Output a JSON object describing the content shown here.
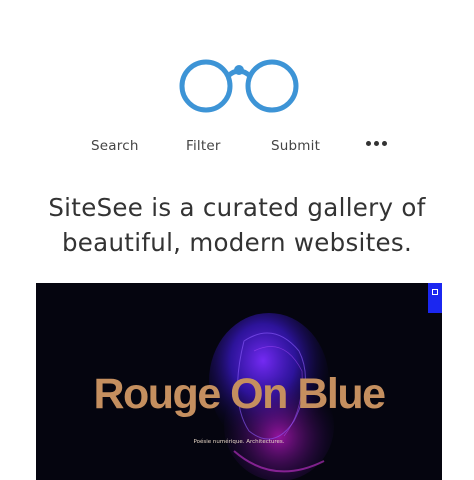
{
  "brand": {
    "logo_icon": "glasses-icon",
    "accent_color": "#3d94d6"
  },
  "nav": {
    "search_label": "Search",
    "filter_label": "Filter",
    "submit_label": "Submit",
    "more_icon": "more-dots-icon"
  },
  "tagline": {
    "line1": "SiteSee is a curated gallery of",
    "line2": "beautiful, modern websites."
  },
  "featured_site": {
    "title": "Rouge On Blue",
    "subtitle": "Poésie numérique. Architectures.",
    "title_color": "#c58f5f",
    "background_color": "#05050f",
    "tab_color": "#1b27f0"
  }
}
